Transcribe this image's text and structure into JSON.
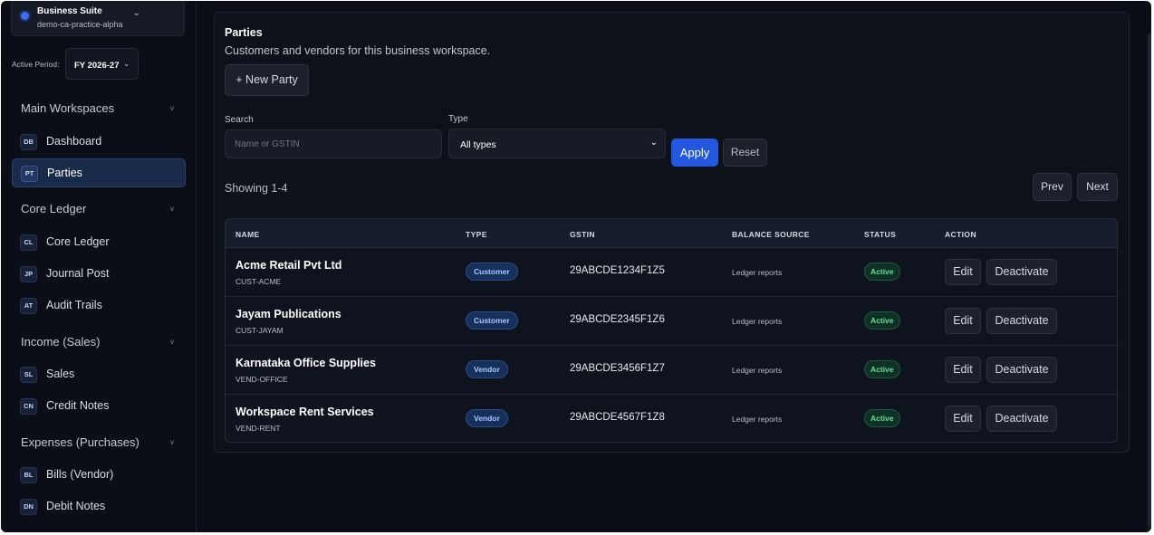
{
  "workspace": {
    "name": "Business Suite",
    "subtitle": "demo-ca-practice-alpha"
  },
  "period": {
    "label": "Active Period:",
    "value": "FY 2026-27"
  },
  "sidebar": {
    "groups": [
      {
        "title": "Main Workspaces"
      },
      {
        "title": "Core Ledger"
      },
      {
        "title": "Income (Sales)"
      },
      {
        "title": "Expenses (Purchases)"
      }
    ],
    "items": [
      {
        "badge": "DB",
        "label": "Dashboard"
      },
      {
        "badge": "PT",
        "label": "Parties",
        "active": true
      },
      {
        "badge": "CL",
        "label": "Core Ledger"
      },
      {
        "badge": "JP",
        "label": "Journal Post"
      },
      {
        "badge": "AT",
        "label": "Audit Trails"
      },
      {
        "badge": "SL",
        "label": "Sales"
      },
      {
        "badge": "CN",
        "label": "Credit Notes"
      },
      {
        "badge": "BL",
        "label": "Bills (Vendor)"
      },
      {
        "badge": "DN",
        "label": "Debit Notes"
      }
    ]
  },
  "page": {
    "title": "Parties",
    "subtitle": "Customers and vendors for this business workspace.",
    "new_button": "+ New Party"
  },
  "filters": {
    "search_label": "Search",
    "search_placeholder": "Name or GSTIN",
    "type_label": "Type",
    "type_value": "All types",
    "apply": "Apply",
    "reset": "Reset"
  },
  "pagination": {
    "showing": "Showing 1-4",
    "prev": "Prev",
    "next": "Next"
  },
  "table": {
    "headers": [
      "NAME",
      "TYPE",
      "GSTIN",
      "BALANCE SOURCE",
      "STATUS",
      "ACTION"
    ],
    "rows": [
      {
        "name": "Acme Retail Pvt Ltd",
        "code": "CUST-ACME",
        "type": "Customer",
        "gstin": "29ABCDE1234F1Z5",
        "balance_source": "Ledger reports",
        "status": "Active",
        "edit": "Edit",
        "deactivate": "Deactivate"
      },
      {
        "name": "Jayam Publications",
        "code": "CUST-JAYAM",
        "type": "Customer",
        "gstin": "29ABCDE2345F1Z6",
        "balance_source": "Ledger reports",
        "status": "Active",
        "edit": "Edit",
        "deactivate": "Deactivate"
      },
      {
        "name": "Karnataka Office Supplies",
        "code": "VEND-OFFICE",
        "type": "Vendor",
        "gstin": "29ABCDE3456F1Z7",
        "balance_source": "Ledger reports",
        "status": "Active",
        "edit": "Edit",
        "deactivate": "Deactivate"
      },
      {
        "name": "Workspace Rent Services",
        "code": "VEND-RENT",
        "type": "Vendor",
        "gstin": "29ABCDE4567F1Z8",
        "balance_source": "Ledger reports",
        "status": "Active",
        "edit": "Edit",
        "deactivate": "Deactivate"
      }
    ]
  },
  "icons": {
    "chevron": "chevron-down-icon",
    "workspace_dot": "status-dot-icon"
  },
  "colors": {
    "accent": "#2357e0",
    "active_status": "#5ee09a",
    "type_pill": "#a9c6ff"
  }
}
